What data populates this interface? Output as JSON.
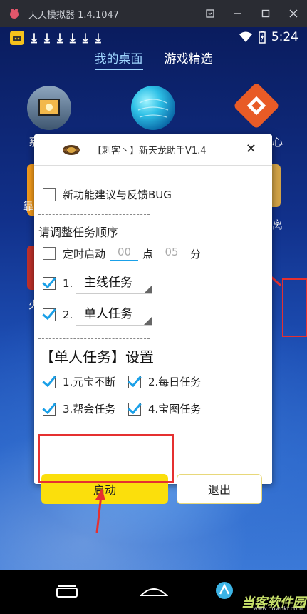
{
  "window": {
    "title": "天天模拟器 1.4.1047",
    "controls": [
      "settings-icon",
      "minimize-icon",
      "maximize-icon",
      "close-icon"
    ]
  },
  "statusbar": {
    "time": "5:24",
    "download_count": 6
  },
  "launcher": {
    "tabs": [
      {
        "label": "我的桌面",
        "active": true
      },
      {
        "label": "游戏精选",
        "active": false
      }
    ]
  },
  "dialog": {
    "title": "【刺客丶】新天龙助手V1.4",
    "feedback_label": "新功能建议与反馈BUG",
    "order_title": "请调整任务顺序",
    "timer_label": "定时启动",
    "timer_hour": "00",
    "timer_hour_unit": "点",
    "timer_minute": "05",
    "timer_minute_unit": "分",
    "task1_num": "1.",
    "task1_value": "主线任务",
    "task2_num": "2.",
    "task2_value": "单人任务",
    "section_title": "【单人任务】设置",
    "options": [
      {
        "label": "1.元宝不断",
        "checked": true
      },
      {
        "label": "2.每日任务",
        "checked": true
      },
      {
        "label": "3.帮会任务",
        "checked": true
      },
      {
        "label": "4.宝图任务",
        "checked": true
      }
    ],
    "start_label": "启动",
    "exit_label": "退出"
  },
  "bg_labels": {
    "left1": "系",
    "left2": "靠",
    "left3": "火",
    "right1": "心",
    "right2": "离"
  },
  "watermark": {
    "text": "当客软件园",
    "url": "www.downkr.com"
  },
  "colors": {
    "accent_yellow": "#fbdf0c",
    "check_blue": "#1aa0e8",
    "highlight_red": "#e53030"
  }
}
